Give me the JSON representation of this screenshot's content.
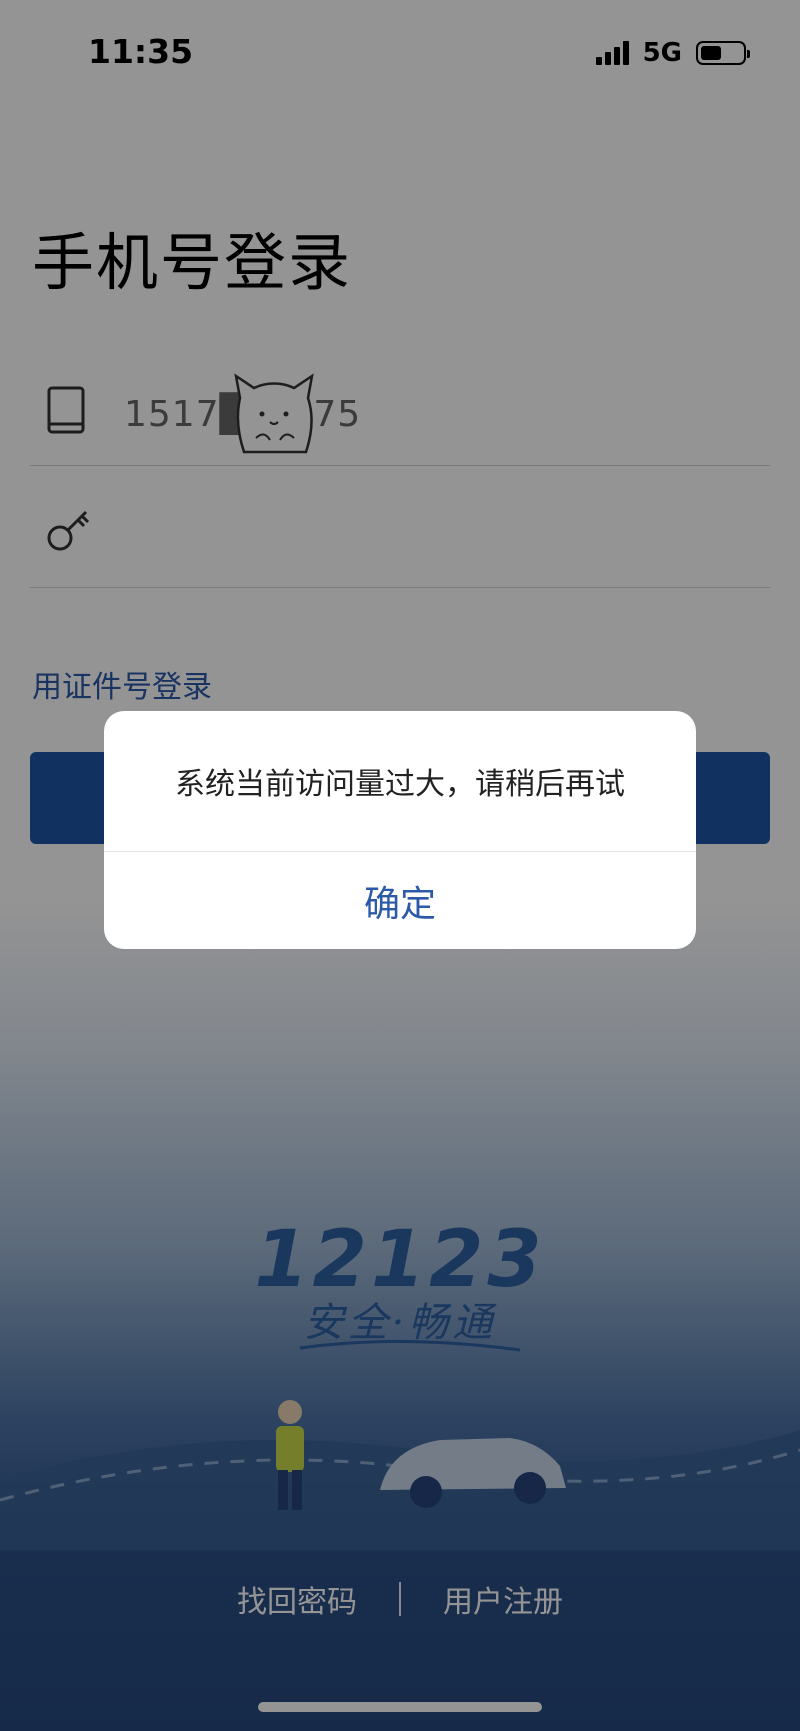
{
  "status_bar": {
    "time": "11:35",
    "network": "5G",
    "battery_level": 0.5
  },
  "login": {
    "title": "手机号登录",
    "phone_value": "1517█ █875",
    "alt_login_link": "用证件号登录"
  },
  "brand": {
    "number": "12123",
    "slogan": "安全·畅通"
  },
  "footer": {
    "find_password": "找回密码",
    "register": "用户注册"
  },
  "dialog": {
    "message": "系统当前访问量过大，请稍后再试",
    "confirm": "确定"
  },
  "colors": {
    "primary": "#1e56a6",
    "link": "#2d5aa8"
  },
  "icons": [
    "tablet-icon",
    "key-icon",
    "cat-sticker"
  ]
}
